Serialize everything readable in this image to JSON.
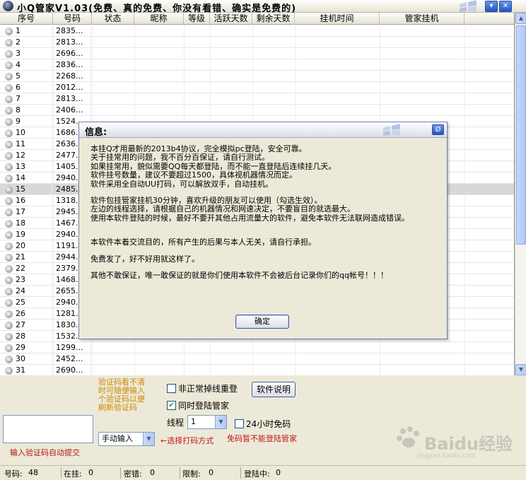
{
  "window": {
    "title": "小Q管家V1.03(免费、真的免费、你没有看错、确实是免费的)",
    "minimize_glyph": "▾",
    "close_glyph": "✕"
  },
  "table": {
    "columns": [
      "序号",
      "号码",
      "状态",
      "昵称",
      "等级",
      "活跃天数",
      "剩余天数",
      "挂机时间",
      "管家挂机"
    ],
    "rows": [
      {
        "num": "1",
        "qq": "2835..."
      },
      {
        "num": "2",
        "qq": "2813..."
      },
      {
        "num": "3",
        "qq": "2696..."
      },
      {
        "num": "4",
        "qq": "2836..."
      },
      {
        "num": "5",
        "qq": "2268..."
      },
      {
        "num": "6",
        "qq": "2012..."
      },
      {
        "num": "7",
        "qq": "2813..."
      },
      {
        "num": "8",
        "qq": "2406..."
      },
      {
        "num": "9",
        "qq": "1524..."
      },
      {
        "num": "10",
        "qq": "1686..."
      },
      {
        "num": "11",
        "qq": "2636..."
      },
      {
        "num": "12",
        "qq": "2477..."
      },
      {
        "num": "13",
        "qq": "1405..."
      },
      {
        "num": "14",
        "qq": "2940..."
      },
      {
        "num": "15",
        "qq": "2485..."
      },
      {
        "num": "16",
        "qq": "1318..."
      },
      {
        "num": "17",
        "qq": "2945..."
      },
      {
        "num": "18",
        "qq": "1467..."
      },
      {
        "num": "19",
        "qq": "2940..."
      },
      {
        "num": "20",
        "qq": "1191..."
      },
      {
        "num": "21",
        "qq": "2944..."
      },
      {
        "num": "22",
        "qq": "2379..."
      },
      {
        "num": "23",
        "qq": "1468..."
      },
      {
        "num": "24",
        "qq": "2655..."
      },
      {
        "num": "25",
        "qq": "2940..."
      },
      {
        "num": "26",
        "qq": "1281..."
      },
      {
        "num": "27",
        "qq": "1830..."
      },
      {
        "num": "28",
        "qq": "1532..."
      },
      {
        "num": "29",
        "qq": "1299..."
      },
      {
        "num": "30",
        "qq": "2452..."
      },
      {
        "num": "31",
        "qq": "2690..."
      }
    ],
    "selected_row": "15"
  },
  "dialog": {
    "title": "信息:",
    "close_glyph": "Ø",
    "paragraphs": [
      [
        "本挂Q才用最新的2013b4协议，完全模拟pc登陆，安全可靠。",
        "关于挂常用的问题，我不百分百保证，请自行测试。",
        "如果挂常用，貌似需要QQ每天都登陆，而不能一直登陆后连续挂几天。",
        "软件挂号数量，建议不要超过1500，具体视机器情况而定。",
        "软件采用全自动UU打码，可以解放双手，自动挂机。"
      ],
      [
        "软件包挂管家挂机30分钟，喜欢升级的朋友可以使用（勾选生效）。",
        "左边的线程选择，请根据自己的机器情况和网速决定，不要盲目的就选最大。",
        "使用本软件登陆的时候，最好不要开其他占用流量大的软件，避免本软件无法联网造成错误。"
      ],
      [
        "本软件本着交流目的，所有产生的后果与本人无关，请自行承担。"
      ],
      [
        "免费发了，好不好用就这样了。"
      ],
      [
        "其他不敢保证，唯一敢保证的就是你们使用本软件不会被后台记录你们的qq帐号！！！"
      ]
    ],
    "ok_label": "确定"
  },
  "bottom": {
    "captcha_hint": "验证码看不清时可随便输入个验证码以便刷新验证码",
    "captcha_caption": "输入验证码自动提交",
    "reconnect_label": "非正常掉线重登",
    "reconnect_checked": false,
    "manager_label": "同时登陆管家",
    "manager_checked": true,
    "help_button": "软件说明",
    "thread_label": "线程",
    "thread_value": "1",
    "free_code_label": "24小时免码",
    "free_code_checked": false,
    "input_mode_value": "手动输入",
    "input_mode_note": "←选择打码方式",
    "free_code_note": "免码暂不能登陆管家"
  },
  "status": {
    "count_label": "号码:",
    "count_value": "48",
    "online_label": "在挂:",
    "online_value": "0",
    "pwd_err_label": "密错:",
    "pwd_err_value": "0",
    "limit_label": "限制:",
    "limit_value": "0",
    "logging_label": "登陆中:",
    "logging_value": "0"
  },
  "watermark": {
    "brand": "Baidu经验",
    "url": "jingyan.baidu.com"
  },
  "colors": {
    "window_bg": "#ECE9D8",
    "accent_blue": "#2556C8",
    "hint_orange": "#CC8A00",
    "note_red": "#C01818"
  }
}
